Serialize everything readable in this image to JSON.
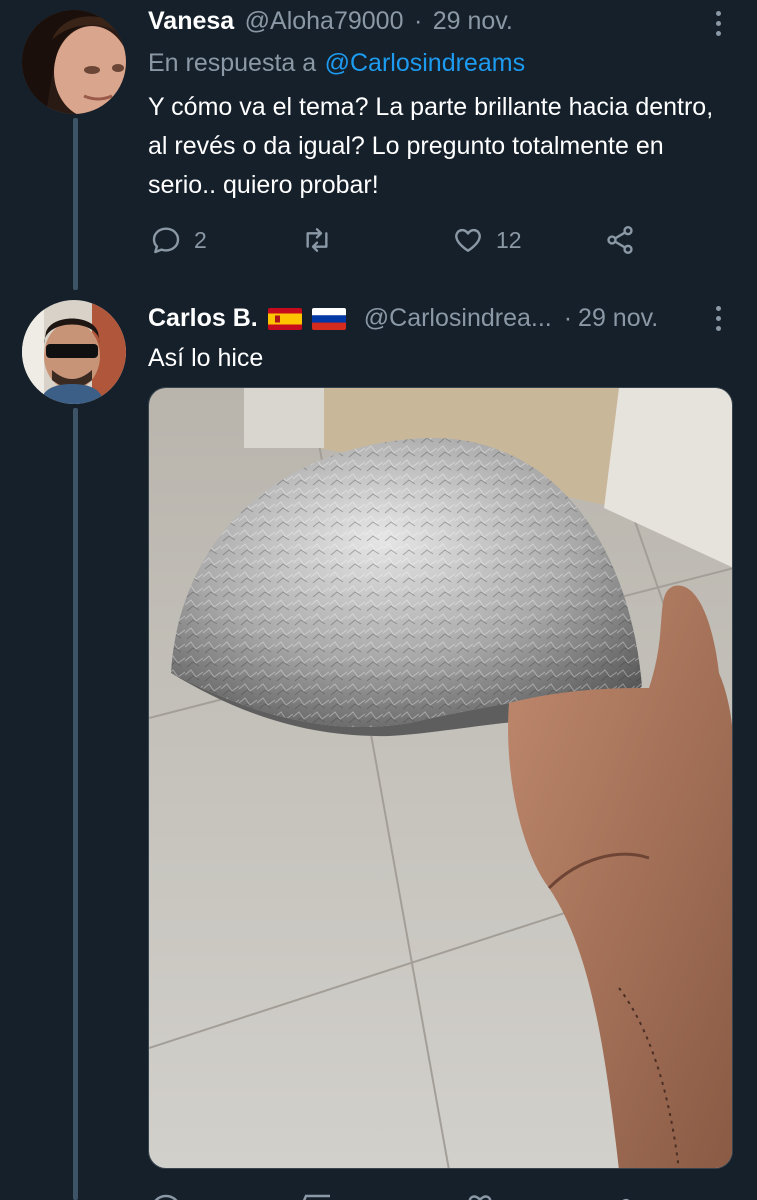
{
  "tweets": [
    {
      "author_name": "Vanesa",
      "handle": "@Aloha79000",
      "separator": "·",
      "date": "29 nov.",
      "reply_prefix": "En respuesta a",
      "reply_to": "@Carlosindreams",
      "text": "Y cómo va el tema? La parte brillante hacia dentro, al revés o da igual? Lo pregunto totalmente en serio.. quiero probar!",
      "actions": {
        "replies": "2",
        "retweets": "",
        "likes": "12"
      }
    },
    {
      "author_name": "Carlos B.",
      "flags": [
        "spain-flag",
        "russia-flag"
      ],
      "handle": "@Carlosindrea...",
      "separator": "·",
      "date": "29 nov.",
      "text": "Así lo hice",
      "media": {
        "icon": "photo-tinfoil-hat"
      }
    }
  ],
  "colors": {
    "background": "#15202b",
    "muted": "#8b98a5",
    "link": "#1d9bf0",
    "thread_line": "#3d5466"
  }
}
